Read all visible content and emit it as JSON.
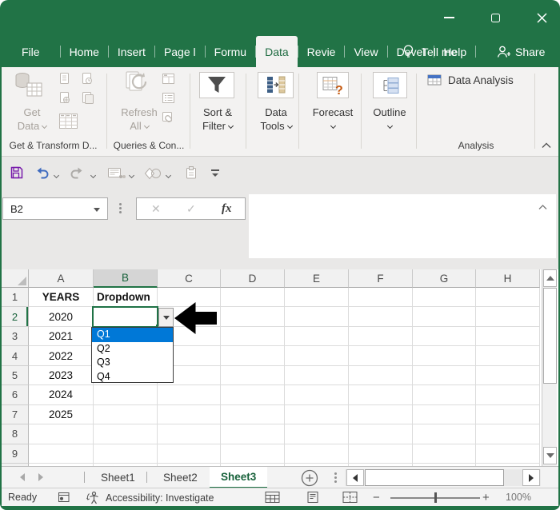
{
  "colors": {
    "excel_green": "#217346",
    "selection_blue": "#0078d7",
    "disabled_gray": "#a6a19b"
  },
  "titlebar": {
    "tabs": [
      "File",
      "Home",
      "Insert",
      "Page l",
      "Formu",
      "Data",
      "Revie",
      "View",
      "Devel",
      "Help"
    ],
    "active_tab": "Data",
    "tell_me": "Tell me",
    "share": "Share"
  },
  "icons": {
    "minimize": "─",
    "maximize": "□",
    "close": "✕",
    "lightbulb": "bulb-outline",
    "share_person": "person-plus",
    "save": "floppy",
    "undo": "curved-arrow-left",
    "redo": "curved-arrow-right",
    "email": "envelope-people",
    "shapes": "diamond-circle",
    "clipboard": "clip-board",
    "customize_toolbar": "bar-over-caret",
    "funnel": "filter-funnel",
    "macro_record": "sheet-dot",
    "accessibility": "person-circle-arrows",
    "add_sheet": "plus-circle",
    "dropdown_caret": "▼",
    "cursor": "black-left-arrow"
  },
  "ribbon": {
    "get_data": {
      "line1": "Get",
      "line2": "Data"
    },
    "refresh_all": {
      "line1": "Refresh",
      "line2": "All"
    },
    "sort_filter": {
      "line1": "Sort &",
      "line2": "Filter"
    },
    "data_tools": {
      "line1": "Data",
      "line2": "Tools"
    },
    "forecast": {
      "line1": "Forecast"
    },
    "outline": {
      "line1": "Outline"
    },
    "data_analysis": "Data Analysis",
    "groups": {
      "get_transform": "Get & Transform D...",
      "queries": "Queries & Con...",
      "analysis": "Analysis"
    }
  },
  "formula_bar": {
    "name_box": "B2",
    "cancel": "✕",
    "enter": "✓",
    "fx": "fx",
    "formula_value": ""
  },
  "grid": {
    "columns": [
      "A",
      "B",
      "C",
      "D",
      "E",
      "F",
      "G",
      "H"
    ],
    "row_numbers": [
      "1",
      "2",
      "3",
      "4",
      "5",
      "6",
      "7",
      "8",
      "9"
    ],
    "selected_column": "B",
    "selected_row": "2",
    "selected_cell": "B2",
    "cells": [
      {
        "ref": "A1",
        "value": "YEARS",
        "bold": true
      },
      {
        "ref": "B1",
        "value": "Dropdown",
        "bold": true,
        "align": "left"
      },
      {
        "ref": "A2",
        "value": "2020"
      },
      {
        "ref": "A3",
        "value": "2021"
      },
      {
        "ref": "A4",
        "value": "2022"
      },
      {
        "ref": "A5",
        "value": "2023"
      },
      {
        "ref": "A6",
        "value": "2024"
      },
      {
        "ref": "A7",
        "value": "2025"
      }
    ]
  },
  "dropdown": {
    "options": [
      "Q1",
      "Q2",
      "Q3",
      "Q4"
    ],
    "highlighted": "Q1"
  },
  "sheet_bar": {
    "sheets": [
      "Sheet1",
      "Sheet2",
      "Sheet3"
    ],
    "active": "Sheet3"
  },
  "status_bar": {
    "mode": "Ready",
    "accessibility": "Accessibility: Investigate",
    "zoom_level": "100%"
  }
}
